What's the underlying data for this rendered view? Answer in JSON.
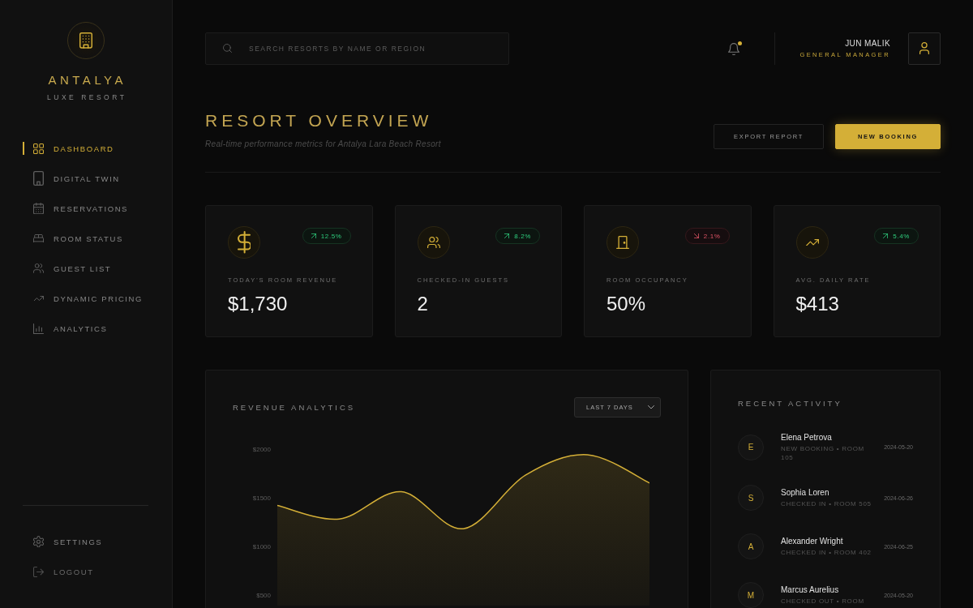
{
  "sidebar": {
    "brand": {
      "name": "ANTALYA",
      "tagline": "LUXE RESORT"
    },
    "nav": [
      {
        "label": "DASHBOARD",
        "selected": true
      },
      {
        "label": "DIGITAL TWIN",
        "selected": false
      },
      {
        "label": "RESERVATIONS",
        "selected": false
      },
      {
        "label": "ROOM STATUS",
        "selected": false
      },
      {
        "label": "GUEST LIST",
        "selected": false
      },
      {
        "label": "DYNAMIC PRICING",
        "selected": false
      },
      {
        "label": "ANALYTICS",
        "selected": false
      }
    ],
    "footer": [
      {
        "label": "SETTINGS",
        "kind": "link"
      },
      {
        "label": "LOGOUT",
        "kind": "exit"
      }
    ]
  },
  "topbar": {
    "search": {
      "placeholder": "SEARCH RESORTS BY NAME OR REGION"
    },
    "notifications": {
      "unread": true
    },
    "user": {
      "name": "JUN MALIK",
      "role": "GENERAL MANAGER"
    }
  },
  "header": {
    "title": "RESORT OVERVIEW",
    "subtitle": "Real-time performance metrics for Antalya Lara Beach Resort",
    "buttons": [
      {
        "label": "EXPORT REPORT",
        "kind": "secondary"
      },
      {
        "label": "NEW BOOKING",
        "kind": "primary"
      }
    ]
  },
  "stats": [
    {
      "label": "TODAY'S ROOM REVENUE",
      "value": "$1,730",
      "change": "12.5%",
      "kind": "up"
    },
    {
      "label": "CHECKED-IN GUESTS",
      "value": "2",
      "change": "8.2%",
      "kind": "up"
    },
    {
      "label": "ROOM OCCUPANCY",
      "value": "50%",
      "change": "2.1%",
      "kind": "down"
    },
    {
      "label": "AVG. DAILY RATE",
      "value": "$413",
      "change": "5.4%",
      "kind": "up"
    }
  ],
  "revenue": {
    "title": "REVENUE ANALYTICS",
    "range": "LAST 7 DAYS",
    "y_axis_labels": [
      "$2000",
      "$1500",
      "$1000",
      "$500"
    ]
  },
  "activity": {
    "title": "RECENT ACTIVITY",
    "items": [
      {
        "initial": "E",
        "name": "Elena Petrova",
        "detail": "NEW BOOKING • ROOM 105",
        "date": "2024-05-20"
      },
      {
        "initial": "S",
        "name": "Sophia Loren",
        "detail": "CHECKED IN • ROOM 505",
        "date": "2024-06-26"
      },
      {
        "initial": "A",
        "name": "Alexander Wright",
        "detail": "CHECKED IN • ROOM 402",
        "date": "2024-06-25"
      },
      {
        "initial": "M",
        "name": "Marcus Aurelius",
        "detail": "CHECKED OUT • ROOM",
        "date": "2024-05-20"
      }
    ]
  }
}
